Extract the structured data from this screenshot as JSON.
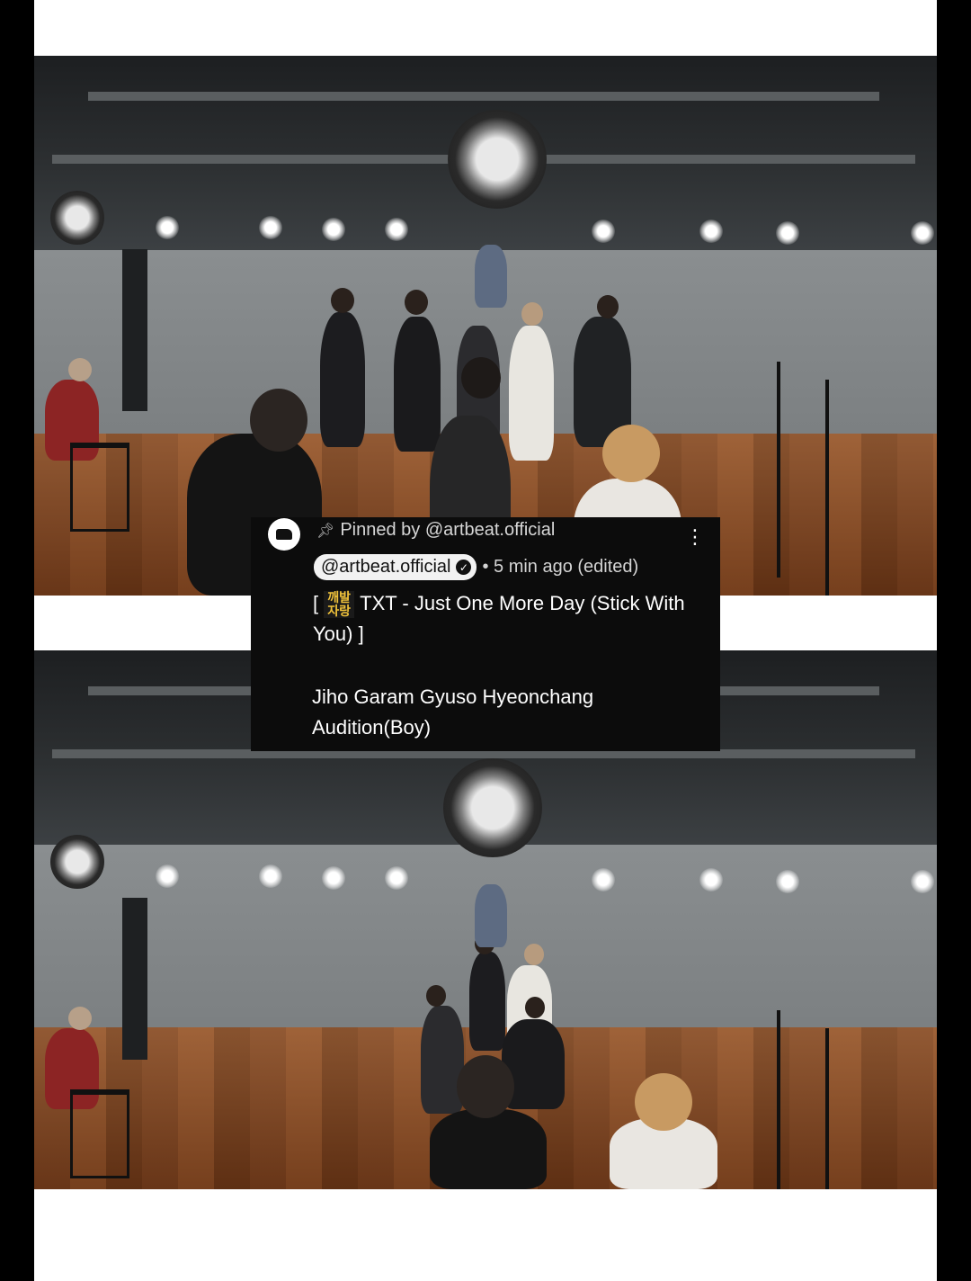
{
  "comment": {
    "pinned_text": "Pinned by @artbeat.official",
    "author_handle": "@artbeat.official",
    "meta": "• 5 min ago (edited)",
    "title_open": "[",
    "emoji_text": "깨발 자랑",
    "title_text": "TXT - Just One More Day (Stick With You) ]",
    "names_line": "Jiho Garam Gyuso Hyeonchang",
    "audition_line": "Audition(Boy)"
  },
  "colors": {
    "card_bg": "#0c0c0c",
    "chip_bg": "#f2f2f2",
    "floor": "#7a3f1c"
  },
  "icons": [
    "pin-icon",
    "verified-icon",
    "more-vert-icon",
    "channel-avatar"
  ]
}
